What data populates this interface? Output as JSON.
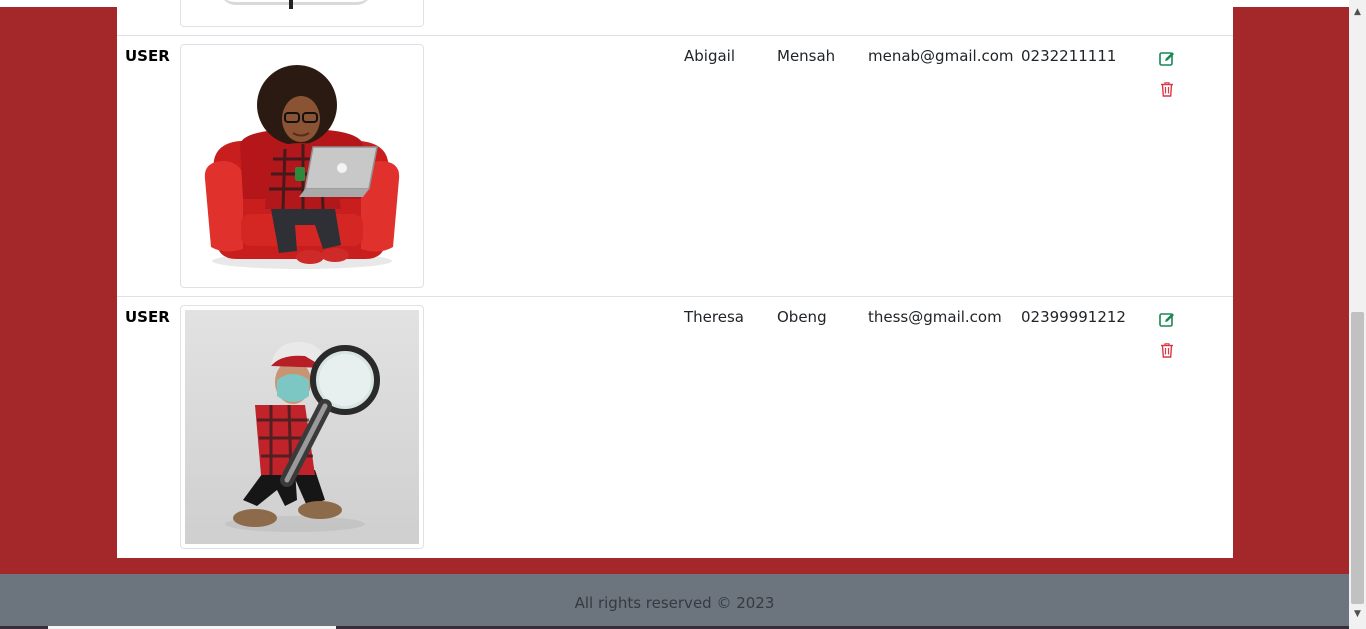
{
  "users": [
    {
      "role": "USER",
      "first_name": "Abigail",
      "last_name": "Mensah",
      "email": "menab@gmail.com",
      "phone": "0232211111",
      "image": "woman-on-red-armchair-with-laptop",
      "edit_icon": "edit-icon",
      "delete_icon": "trash-icon"
    },
    {
      "role": "USER",
      "first_name": "Theresa",
      "last_name": "Obeng",
      "email": "thess@gmail.com",
      "phone": "02399991212",
      "image": "man-with-magnifying-glass",
      "edit_icon": "edit-icon",
      "delete_icon": "trash-icon"
    }
  ],
  "footer": {
    "text": "All rights reserved © 2023"
  },
  "colors": {
    "page_bg": "#a4282a",
    "footer_bg": "#6c757d",
    "edit": "#198754",
    "delete": "#dc3545"
  }
}
